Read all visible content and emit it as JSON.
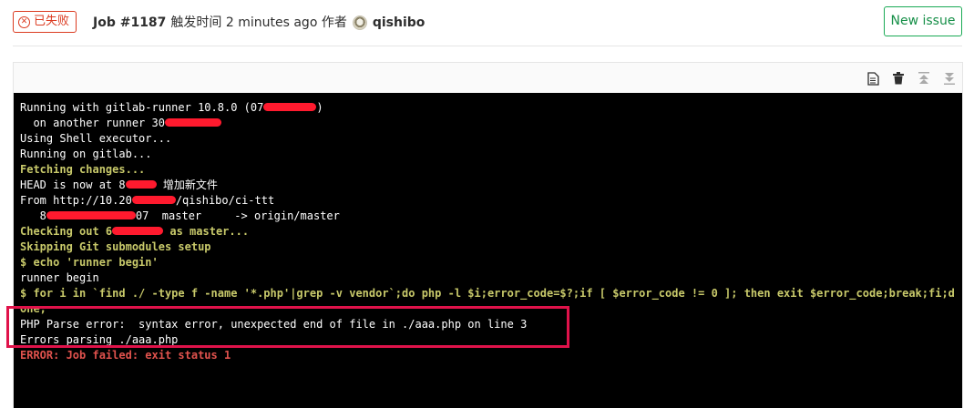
{
  "header": {
    "status_icon": "x-circle-icon",
    "status_label": "已失败",
    "job_id": "Job #1187",
    "triggered_text": "触发时间 2 minutes ago 作者",
    "author": "qishibo",
    "new_issue_label": "New issue"
  },
  "toolbar": {
    "icons": [
      "raw-log-icon",
      "erase-trash-icon",
      "scroll-top-icon",
      "scroll-bottom-icon"
    ]
  },
  "log": {
    "l1_a": "Running with gitlab-runner 10.8.0 (07",
    "l1_b": ")",
    "l2": "  on another runner 30",
    "l3": "Using Shell executor...",
    "l4": "Running on gitlab...",
    "l5": "Fetching changes...",
    "l6_a": "HEAD is now at 8",
    "l6_b": " 增加新文件",
    "l7_a": "From http://10.20",
    "l7_b": "/qishibo/ci-ttt",
    "l8_a": "   8",
    "l8_b": "07  master     -> origin/master",
    "l9_a": "Checking out 6",
    "l9_b": " as master...",
    "l10": "Skipping Git submodules setup",
    "l11": "$ echo 'runner begin'",
    "l12": "runner begin",
    "l13": "$ for i in `find ./ -type f -name '*.php'|grep -v vendor`;do php -l $i;error_code=$?;if [ $error_code != 0 ]; then exit $error_code;break;fi;d",
    "l14": "one;",
    "l15": "PHP Parse error:  syntax error, unexpected end of file in ./aaa.php on line 3",
    "l16": "Errors parsing ./aaa.php",
    "l17": "ERROR: Job failed: exit status 1"
  },
  "colors": {
    "failed": "#db3b21",
    "success_green": "#1aaa55",
    "log_bold": "#c8c96a",
    "log_error": "#e0524d",
    "redaction": "#ff1a2e",
    "highlight_box": "#e0124a"
  }
}
